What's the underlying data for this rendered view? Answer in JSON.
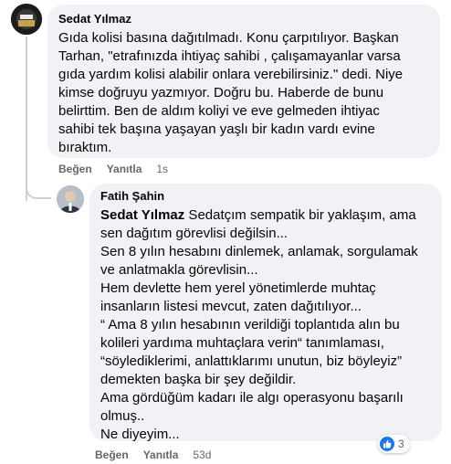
{
  "comment1": {
    "author": "Sedat Yılmaz",
    "lines": [
      "Gıda kolisi basına dağıtılmadı. Konu çarpıtılıyor. Başkan",
      "Tarhan, \"etrafınızda ihtiyaç sahibi , çalışamayanlar varsa",
      "gıda yardım kolisi alabilir onlara verebilirsiniz.\" dedi. Niye",
      "kimse doğruyu yazmıyor. Doğru bu. Haberde de bunu",
      "belirttim. Ben de aldım koliyi ve eve gelmeden ihtiyac",
      "sahibi tek başına yaşayan yaşlı bir kadın vardı evine",
      "bıraktım."
    ],
    "like_label": "Beğen",
    "reply_label": "Yanıtla",
    "time": "1s"
  },
  "reply1": {
    "author": "Fatih Şahin",
    "mention": "Sedat Yılmaz",
    "first_line_rest": " Sedatçım sempatik bir yaklaşım, ama",
    "lines": [
      "sen dağıtım görevlisi değilsin...",
      "Sen 8 yılın hesabını dinlemek, anlamak, sorgulamak",
      "ve anlatmakla görevlisin...",
      "Hem devlette hem yerel yönetimlerde muhtaç",
      "insanların listesi mevcut, zaten dağıtılıyor...",
      "“ Ama 8 yılın hesabının verildiği toplantıda alın bu",
      "kolileri yardıma muhtaçlara verin“ tanımlaması,",
      "“söylediklerimi, anlattıklarımı unutun, biz böyleyiz”",
      "demekten başka bir şey değildir.",
      "Ama gördüğüm kadarı ile algı operasyonu başarılı",
      "olmuş..",
      "Ne diyeyim..."
    ],
    "like_label": "Beğen",
    "reply_label": "Yanıtla",
    "time": "53d",
    "reaction_count": "3"
  },
  "colors": {
    "bubble": "#f0f2f5",
    "meta": "#65676b",
    "like_blue": "#1877f2"
  }
}
